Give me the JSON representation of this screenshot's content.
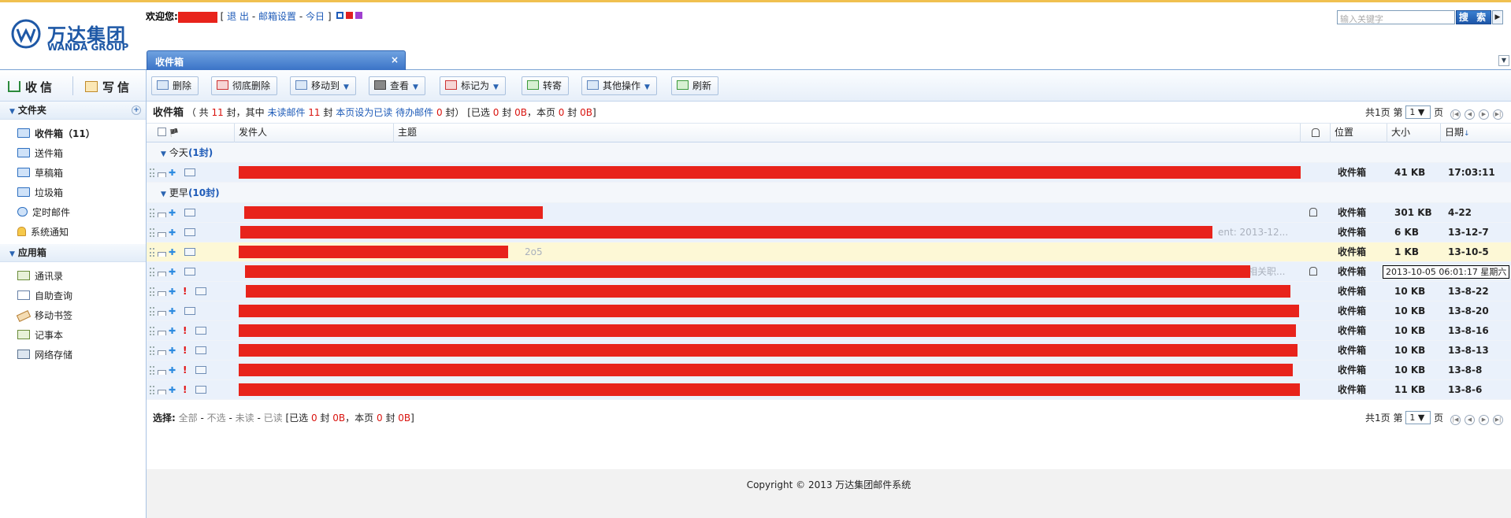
{
  "header": {
    "logo_cn": "万达集团",
    "logo_en": "WANDA GROUP",
    "welcome_prefix": "欢迎您:",
    "bracket_open": "[",
    "bracket_close": "]",
    "logout": "退 出",
    "settings": "邮箱设置",
    "today": "今日",
    "dash": "-",
    "search_placeholder": "输入关键字",
    "search_button": "搜 索"
  },
  "tab": {
    "label": "收件箱",
    "close": "×"
  },
  "sidebar": {
    "receive": "收信",
    "compose": "写信",
    "folders_title": "文件夹",
    "folders": [
      {
        "label": "收件箱（11）",
        "active": true
      },
      {
        "label": "送件箱"
      },
      {
        "label": "草稿箱"
      },
      {
        "label": "垃圾箱"
      },
      {
        "label": "定时邮件"
      },
      {
        "label": "系统通知"
      }
    ],
    "apps_title": "应用箱",
    "apps": [
      {
        "label": "通讯录"
      },
      {
        "label": "自助查询"
      },
      {
        "label": "移动书签"
      },
      {
        "label": "记事本"
      },
      {
        "label": "网络存储"
      }
    ]
  },
  "toolbar": {
    "delete": "删除",
    "perm_delete": "彻底删除",
    "move_to": "移动到",
    "view": "查看",
    "mark_as": "标记为",
    "forward": "转寄",
    "other_ops": "其他操作",
    "refresh": "刷新"
  },
  "info": {
    "title": "收件箱",
    "t1": "（ 共",
    "total": "11",
    "t2": "封，其中",
    "unread_label": "未读邮件",
    "unread": "11",
    "t3": "封",
    "mark_page_read": "本页设为已读",
    "pending_label": "待办邮件",
    "pending": "0",
    "t4": "封）",
    "t5": "[已选",
    "sel_count": "0",
    "t6": "封",
    "sel_size": "0B",
    "t7": "，本页",
    "page_count": "0",
    "t8": "封",
    "page_size": "0B",
    "t9": "]"
  },
  "pager": {
    "total_prefix": "共1页 第",
    "current": "1",
    "suffix": "页"
  },
  "columns": {
    "sender": "发件人",
    "subject": "主题",
    "location": "位置",
    "size": "大小",
    "date": "日期"
  },
  "groups": {
    "today": {
      "label": "今天",
      "count": "(1封)"
    },
    "earlier": {
      "label": "更早",
      "count": "(10封)"
    }
  },
  "today_rows": [
    {
      "location": "收件箱",
      "size": "41 KB",
      "date": "17:03:11"
    }
  ],
  "earlier_rows": [
    {
      "location": "收件箱",
      "size": "301 KB",
      "date": "4-22",
      "attach": true,
      "important": false
    },
    {
      "location": "收件箱",
      "size": "6 KB",
      "date": "13-12-7",
      "attach": false,
      "important": false,
      "ghost": "ent: 2013-12..."
    },
    {
      "location": "收件箱",
      "size": "1 KB",
      "date": "13-10-5",
      "attach": false,
      "important": false,
      "highlight": true,
      "ghost": "2o5"
    },
    {
      "location": "收件箱",
      "size": "",
      "date": "",
      "attach": true,
      "important": false,
      "ghost": "相关职..."
    },
    {
      "location": "收件箱",
      "size": "10 KB",
      "date": "13-8-22",
      "attach": false,
      "important": true
    },
    {
      "location": "收件箱",
      "size": "10 KB",
      "date": "13-8-20",
      "attach": false,
      "important": false
    },
    {
      "location": "收件箱",
      "size": "10 KB",
      "date": "13-8-16",
      "attach": false,
      "important": true
    },
    {
      "location": "收件箱",
      "size": "10 KB",
      "date": "13-8-13",
      "attach": false,
      "important": true
    },
    {
      "location": "收件箱",
      "size": "10 KB",
      "date": "13-8-8",
      "attach": false,
      "important": true
    },
    {
      "location": "收件箱",
      "size": "11 KB",
      "date": "13-8-6",
      "attach": false,
      "important": true
    }
  ],
  "tooltip": "2013-10-05 06:01:17 星期六",
  "bottom": {
    "select_label": "选择:",
    "all": "全部",
    "none": "不选",
    "unread": "未读",
    "read": "已读",
    "t1": "[已选",
    "sel_count": "0",
    "t2": "封",
    "sel_size": "0B",
    "t3": "，本页",
    "page_count": "0",
    "t4": "封",
    "page_size": "0B",
    "t5": "]"
  },
  "footer": "Copyright © 2013 万达集团邮件系统",
  "colors": {
    "accent": "#1e5bb8",
    "tab": "#3b73c7",
    "redaction": "#e8231b",
    "highlight_row": "#fdf8d6"
  }
}
